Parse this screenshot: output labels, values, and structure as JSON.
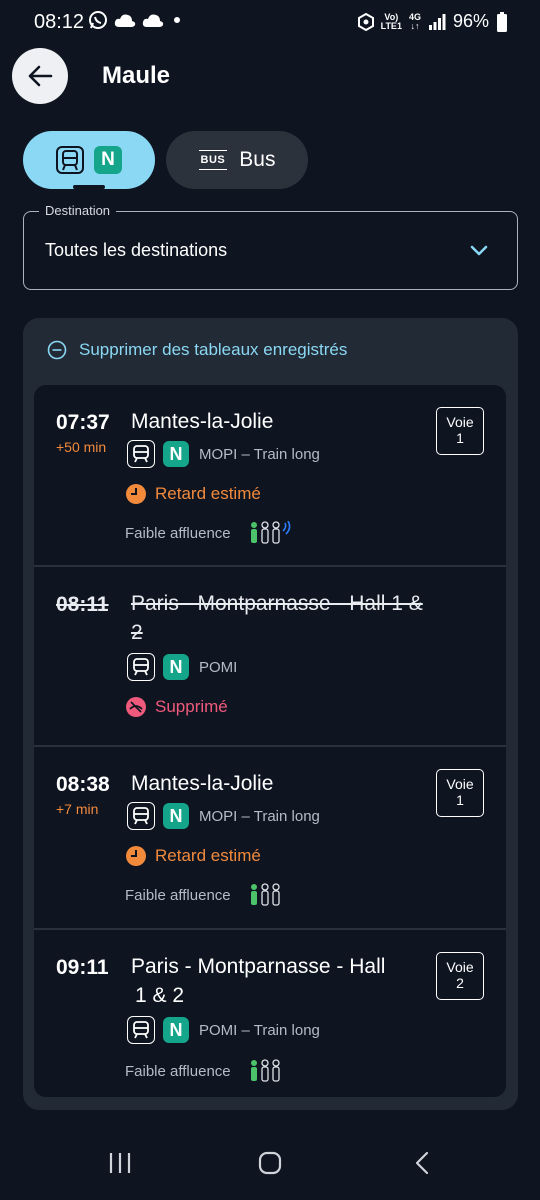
{
  "status_bar": {
    "time": "08:12",
    "network_top": "Vo)",
    "network_bottom": "LTE1",
    "network_type": "4G",
    "battery": "96%"
  },
  "header": {
    "title": "Maule"
  },
  "modes": {
    "bus_logo": "BUS",
    "bus_label": "Bus",
    "train_line_badge": "N"
  },
  "destination": {
    "legend": "Destination",
    "value": "Toutes les destinations"
  },
  "remove_label": "Supprimer des tableaux enregistrés",
  "colors": {
    "accent": "#8ad8f4",
    "line_n": "#14a58a",
    "delay": "#f28a3c",
    "cancelled": "#ef5a7c"
  },
  "departures": [
    {
      "time": "07:37",
      "delay": "+50 min",
      "destination": "Mantes-la-Jolie",
      "line_badge": "N",
      "mission": "MOPI – Train long",
      "status": "Retard estimé",
      "crowd": "Faible affluence",
      "voie_label": "Voie",
      "voie_number": "1"
    },
    {
      "time": "08:11",
      "destination_line1": "Paris - Montparnasse - Hall 1 &",
      "destination_line2": "2",
      "line_badge": "N",
      "mission": "POMI",
      "status": "Supprimé"
    },
    {
      "time": "08:38",
      "delay": "+7 min",
      "destination": "Mantes-la-Jolie",
      "line_badge": "N",
      "mission": "MOPI – Train long",
      "status": "Retard estimé",
      "crowd": "Faible affluence",
      "voie_label": "Voie",
      "voie_number": "1"
    },
    {
      "time": "09:11",
      "destination_line1": "Paris - Montparnasse - Hall",
      "destination_line2": "1 & 2",
      "line_badge": "N",
      "mission": "POMI – Train long",
      "crowd": "Faible affluence",
      "voie_label": "Voie",
      "voie_number": "2"
    }
  ]
}
